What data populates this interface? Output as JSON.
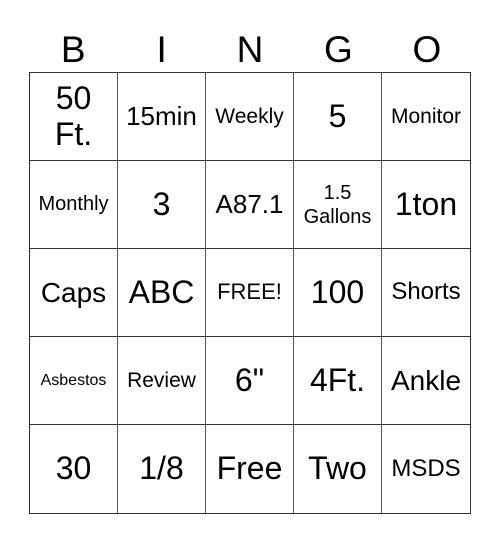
{
  "header": {
    "letters": [
      "B",
      "I",
      "N",
      "G",
      "O"
    ]
  },
  "cells": [
    [
      "50 Ft.",
      "15min",
      "Weekly",
      "5",
      "Monitor"
    ],
    [
      "Monthly",
      "3",
      "A87.1",
      "1.5 Gallons",
      "1ton"
    ],
    [
      "Caps",
      "ABC",
      "FREE!",
      "100",
      "Shorts"
    ],
    [
      "Asbestos",
      "Review",
      "6\"",
      "4Ft.",
      "Ankle"
    ],
    [
      "30",
      "1/8",
      "Free",
      "Two",
      "MSDS"
    ]
  ]
}
